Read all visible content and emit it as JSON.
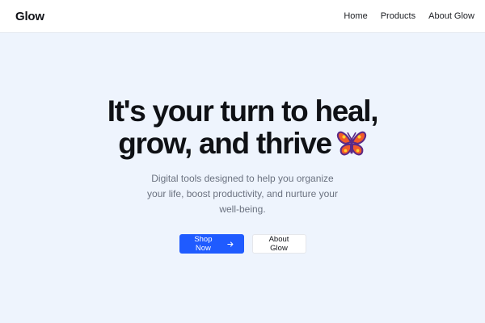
{
  "header": {
    "brand": "Glow",
    "nav": [
      {
        "label": "Home"
      },
      {
        "label": "Products"
      },
      {
        "label": "About Glow"
      }
    ]
  },
  "hero": {
    "headline_line1": "It's your turn to heal,",
    "headline_line2": "grow, and thrive",
    "subtitle": "Digital tools designed to help you organize your life, boost productivity, and nurture your well-being.",
    "primary_button": "Shop Now",
    "secondary_button": "About Glow"
  },
  "icons": {
    "butterfly": "butterfly-icon",
    "arrow": "arrow-right-icon"
  },
  "colors": {
    "background": "#eef4fd",
    "primary": "#1f5bff",
    "text": "#0f1115",
    "muted": "#6b7280"
  }
}
